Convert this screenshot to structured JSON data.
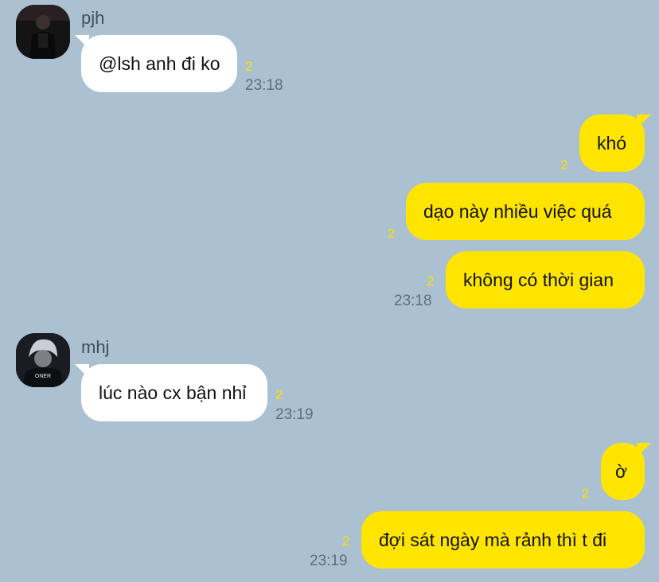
{
  "chat": {
    "groups": [
      {
        "sender": "pjh",
        "avatar_icon": "profile-photo-dark",
        "messages": [
          {
            "text": "@lsh anh đi ko",
            "unread": "2",
            "time": "23:18"
          }
        ]
      },
      {
        "sender": "me",
        "messages": [
          {
            "text": "khó",
            "unread": "2"
          },
          {
            "text": "dạo này nhiều việc quá",
            "unread": "2"
          },
          {
            "text": "không có thời gian",
            "unread": "2",
            "time": "23:18"
          }
        ]
      },
      {
        "sender": "mhj",
        "avatar_icon": "profile-photo-onner",
        "messages": [
          {
            "text": "lúc nào cx bận nhỉ",
            "unread": "2",
            "time": "23:19"
          }
        ]
      },
      {
        "sender": "me",
        "messages": [
          {
            "text": "ờ",
            "unread": "2"
          },
          {
            "text": "đợi sát ngày mà rảnh thì t đi",
            "unread": "2",
            "time": "23:19"
          }
        ]
      }
    ],
    "avatar_caption": "ONER"
  },
  "colors": {
    "background": "#abc1d1",
    "incoming_bubble": "#ffffff",
    "outgoing_bubble": "#fee500",
    "unread_count": "#ffe000",
    "timestamp": "#5f6e79"
  }
}
